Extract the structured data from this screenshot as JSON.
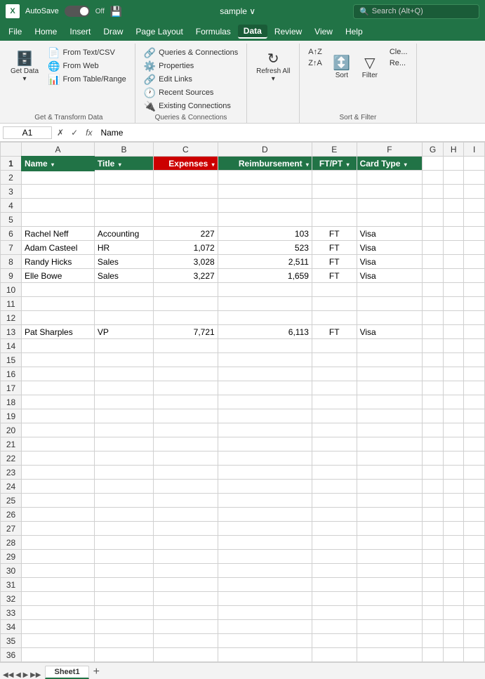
{
  "titlebar": {
    "autosave_label": "AutoSave",
    "autosave_state": "Off",
    "filename": "sample",
    "search_placeholder": "Search (Alt+Q)"
  },
  "menubar": {
    "items": [
      "File",
      "Home",
      "Insert",
      "Draw",
      "Page Layout",
      "Formulas",
      "Data",
      "Review",
      "View",
      "Help"
    ]
  },
  "ribbon": {
    "get_transform": {
      "label": "Get & Transform Data",
      "get_data_label": "Get Data",
      "from_text_csv": "From Text/CSV",
      "from_web": "From Web",
      "from_table": "From Table/Range"
    },
    "queries": {
      "label": "Queries & Connections",
      "queries_connections": "Queries & Connections",
      "properties": "Properties",
      "edit_links": "Edit Links",
      "recent_sources": "Recent Sources",
      "existing_connections": "Existing Connections"
    },
    "refresh": {
      "label": "",
      "refresh_all": "Refresh All",
      "icon": "↻"
    },
    "sort_filter": {
      "label": "Sort & Filter",
      "sort_az": "A↑Z",
      "sort_za": "Z↑A",
      "sort": "Sort",
      "filter": "Filter",
      "clear": "Cle...",
      "reapply": "Re..."
    }
  },
  "formula_bar": {
    "cell_ref": "A1",
    "formula": "Name"
  },
  "columns": [
    "",
    "A",
    "B",
    "C",
    "D",
    "E",
    "F",
    "G",
    "H",
    "I"
  ],
  "header_row": {
    "row_num": "1",
    "name": "Name",
    "title": "Title",
    "expenses": "Expenses",
    "reimbursement": "Reimbursement",
    "ftpt": "FT/PT",
    "card_type": "Card Type"
  },
  "rows": [
    {
      "num": "2",
      "empty": true
    },
    {
      "num": "3",
      "empty": true
    },
    {
      "num": "4",
      "empty": true
    },
    {
      "num": "5",
      "empty": true
    },
    {
      "num": "6",
      "name": "Rachel Neff",
      "title": "Accounting",
      "expenses": "227",
      "reimb": "103",
      "ftpt": "FT",
      "card": "Visa"
    },
    {
      "num": "7",
      "name": "Adam Casteel",
      "title": "HR",
      "expenses": "1,072",
      "reimb": "523",
      "ftpt": "FT",
      "card": "Visa"
    },
    {
      "num": "8",
      "name": "Randy Hicks",
      "title": "Sales",
      "expenses": "3,028",
      "reimb": "2,511",
      "ftpt": "FT",
      "card": "Visa"
    },
    {
      "num": "9",
      "name": "Elle Bowe",
      "title": "Sales",
      "expenses": "3,227",
      "reimb": "1,659",
      "ftpt": "FT",
      "card": "Visa"
    },
    {
      "num": "10",
      "empty": true
    },
    {
      "num": "11",
      "empty": true
    },
    {
      "num": "12",
      "empty": true
    },
    {
      "num": "13",
      "name": "Pat Sharples",
      "title": "VP",
      "expenses": "7,721",
      "reimb": "6,113",
      "ftpt": "FT",
      "card": "Visa"
    },
    {
      "num": "14",
      "empty": true
    },
    {
      "num": "15",
      "empty": true
    },
    {
      "num": "16",
      "empty": true
    },
    {
      "num": "17",
      "empty": true
    },
    {
      "num": "18",
      "empty": true
    },
    {
      "num": "19",
      "empty": true
    },
    {
      "num": "20",
      "empty": true
    },
    {
      "num": "21",
      "empty": true
    },
    {
      "num": "22",
      "empty": true
    },
    {
      "num": "23",
      "empty": true
    },
    {
      "num": "24",
      "empty": true
    },
    {
      "num": "25",
      "empty": true
    },
    {
      "num": "26",
      "empty": true
    },
    {
      "num": "27",
      "empty": true
    },
    {
      "num": "28",
      "empty": true
    },
    {
      "num": "29",
      "empty": true
    },
    {
      "num": "30",
      "empty": true
    },
    {
      "num": "31",
      "empty": true
    },
    {
      "num": "32",
      "empty": true
    },
    {
      "num": "33",
      "empty": true
    },
    {
      "num": "34",
      "empty": true
    },
    {
      "num": "35",
      "empty": true
    },
    {
      "num": "36",
      "empty": true
    }
  ],
  "sheet_tabs": [
    "Sheet1"
  ],
  "colors": {
    "excel_green": "#217346",
    "excel_red": "#cc0000"
  }
}
